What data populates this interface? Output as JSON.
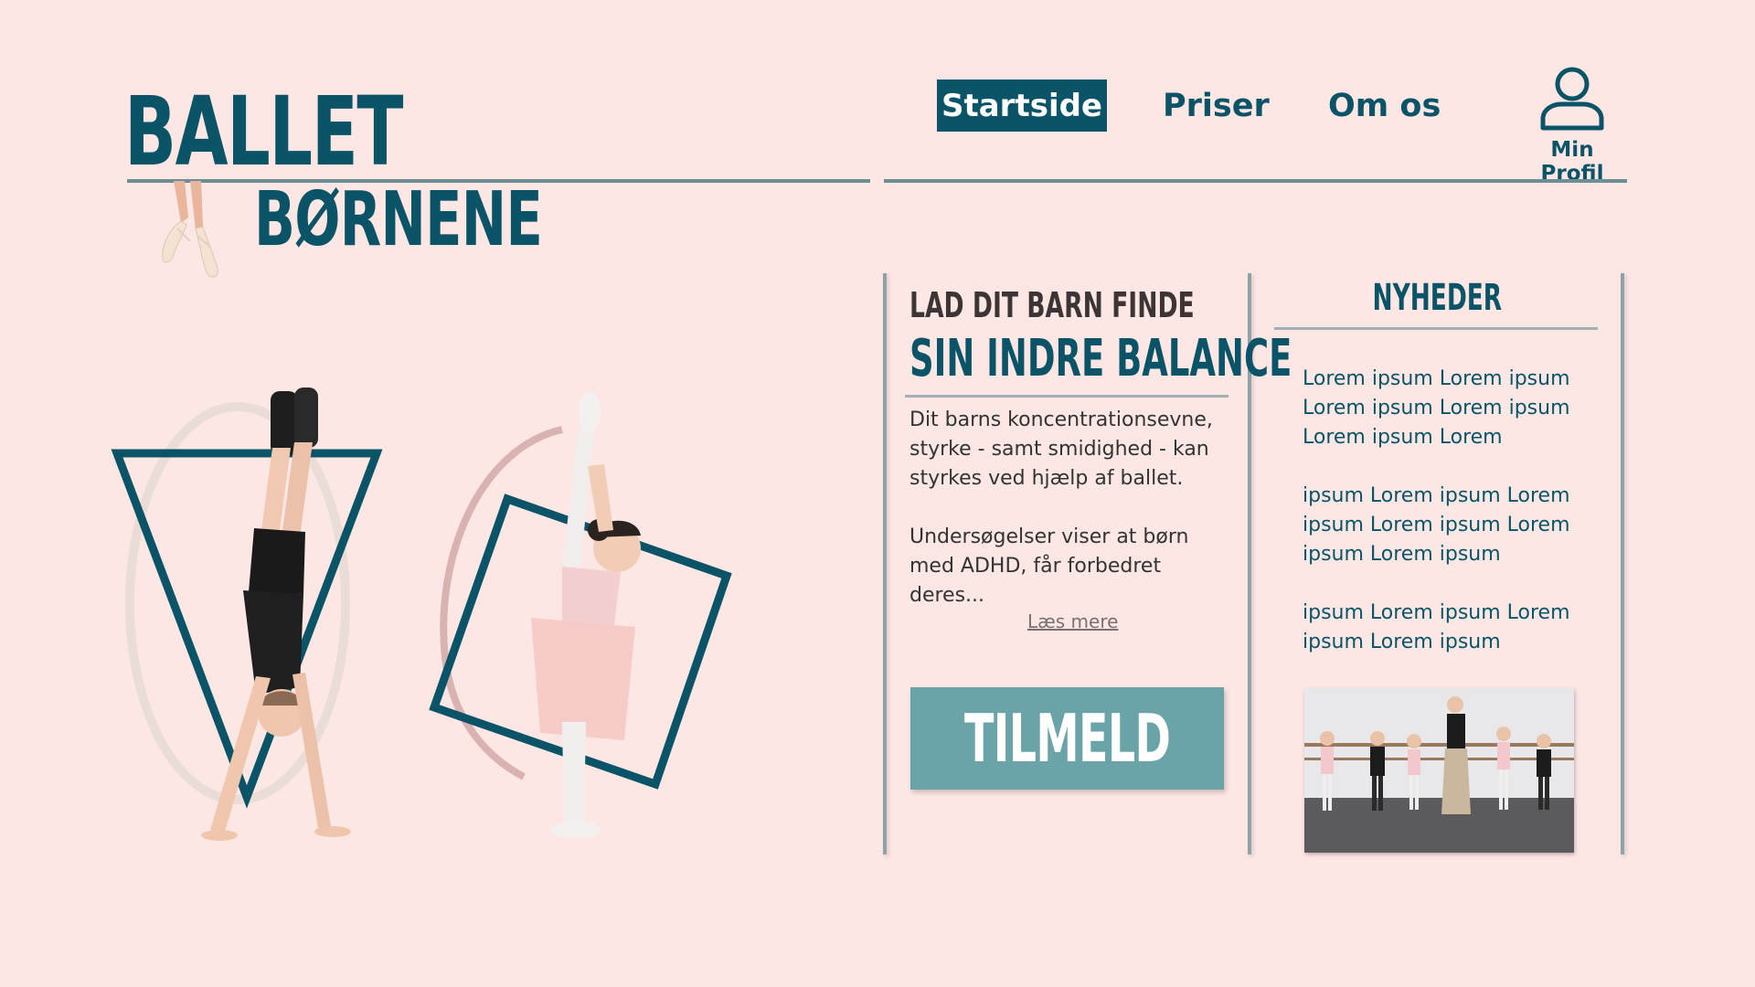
{
  "logo": {
    "line1": "BALLET",
    "line2": "BØRNENE"
  },
  "nav": {
    "items": [
      {
        "label": "Startside",
        "active": true
      },
      {
        "label": "Priser",
        "active": false
      },
      {
        "label": "Om os",
        "active": false
      }
    ],
    "profile_label": "Min Profil"
  },
  "article": {
    "pre_title": "LAD DIT BARN FINDE",
    "title": "SIN INDRE BALANCE",
    "paragraph1": "Dit barns koncentrationsevne, styrke - samt smidighed - kan styrkes ved hjælp af ballet.",
    "paragraph2": "Undersøgelser viser at børn med ADHD, får forbedret deres...",
    "read_more": "Læs mere",
    "signup_label": "TILMELD"
  },
  "news": {
    "title": "NYHEDER",
    "items": [
      "Lorem ipsum Lorem ipsum Lorem ipsum Lorem ipsum Lorem ipsum Lorem",
      "ipsum Lorem ipsum Lorem ipsum Lorem ipsum Lorem ipsum Lorem ipsum",
      "ipsum Lorem ipsum Lorem ipsum Lorem ipsum"
    ]
  },
  "colors": {
    "background": "#fde7e5",
    "brand": "#0b5468",
    "signup": "#6aa4a8",
    "rule": "#6e8e96"
  },
  "icons": [
    "ballet-shoes-icon",
    "user-profile-icon"
  ]
}
